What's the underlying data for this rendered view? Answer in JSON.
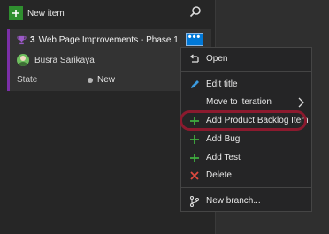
{
  "toolbar": {
    "new_item_label": "New item"
  },
  "card": {
    "number": "3",
    "title": "Web Page Improvements - Phase 1",
    "more_label": "•••",
    "assignee": "Busra Sarikaya",
    "state_label": "State",
    "state_value": "New"
  },
  "menu": {
    "items": [
      {
        "label": "Open",
        "icon": "open-icon"
      },
      {
        "label": "Edit title",
        "icon": "pencil-icon"
      },
      {
        "label": "Move to iteration",
        "icon": "none"
      },
      {
        "label": "Add Product Backlog Item",
        "icon": "plus-icon"
      },
      {
        "label": "Add Bug",
        "icon": "plus-icon"
      },
      {
        "label": "Add Test",
        "icon": "plus-icon"
      },
      {
        "label": "Delete",
        "icon": "x-icon"
      },
      {
        "label": "New branch...",
        "icon": "branch-icon"
      }
    ]
  },
  "colors": {
    "accent_purple": "#7b2fa8",
    "menu_button_blue": "#0078d7",
    "add_green": "#2f8f2f",
    "delete_red": "#e04a3f",
    "highlight_ring": "#8b1a2e"
  }
}
